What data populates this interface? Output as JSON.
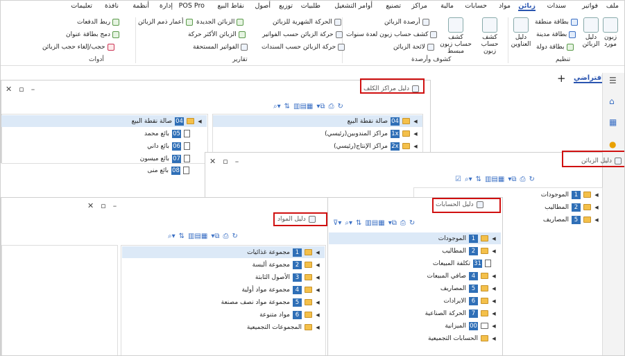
{
  "menu": {
    "items": [
      "ملف",
      "فواتير",
      "سندات",
      "زبائن",
      "مواد",
      "حسابات",
      "مالية",
      "مراكز",
      "تصنيع",
      "أوامر التشغيل",
      "طلبيات",
      "توزيع",
      "أصول",
      "نقاط البيع",
      "POS Pro",
      "إدارة",
      "أنظمة",
      "نافذة",
      "تعليمات"
    ],
    "active": "زبائن"
  },
  "ribbon": {
    "tanzeem": {
      "label": "تنظيم",
      "btn_customer_supplier": "زبون مورد",
      "btn_customers_guide": "دليل الزبائن",
      "btn_region_card": "بطاقة منطقة",
      "btn_city_card": "بطاقة مدينة",
      "btn_country_card": "بطاقة دولة",
      "btn_address_guide": "دليل العناوين"
    },
    "kashf": {
      "label": "كشوف وأرصدة",
      "btn_customer_statement": "كشف حساب زبون",
      "btn_simple_statement": "كشف حساب زبون مبسط",
      "btn_balances": "أرصدة الزبائن",
      "btn_multi_year": "كشف حساب زبون لعدة سنوات",
      "btn_list": "لائحة الزبائن"
    },
    "reports": {
      "label": "تقارير",
      "btn_monthly": "الحركة الشهرية للزبائن",
      "btn_by_invoices": "حركة الزبائن حسب الفواتير",
      "btn_by_vouchers": "حركة الزبائن حسب السندات",
      "btn_new": "الزبائن الجديدة",
      "btn_most_active": "الزبائن الأكثر حركة",
      "btn_due": "الفواتير المستحقة",
      "btn_aging": "أعمار ذمم الزبائن"
    },
    "tools": {
      "label": "أدوات",
      "btn_link_payments": "ربط الدفعات",
      "btn_merge_address": "دمج بطاقة عنوان",
      "btn_hide_customers": "حجب/إلغاء حجب الزبائن"
    }
  },
  "tabs": {
    "default_tab": "افتراضي",
    "add": "+"
  },
  "cost_centers": {
    "title": "دليل مراكز الكلف",
    "left_rows": [
      {
        "num": "04",
        "label": "صالة نقطة البيع",
        "type": "folder",
        "selected": true
      },
      {
        "num": "05",
        "label": "بائع محمد",
        "type": "doc"
      },
      {
        "num": "06",
        "label": "بائع داني",
        "type": "doc"
      },
      {
        "num": "07",
        "label": "بائع ميسون",
        "type": "doc"
      },
      {
        "num": "08",
        "label": "بائع منى",
        "type": "doc"
      }
    ],
    "right_rows": [
      {
        "num": "04",
        "label": "صالة نقطة البيع",
        "type": "folder",
        "selected": true
      },
      {
        "num": "1x",
        "label": "مراكز المندوبين(رئيسي)",
        "type": "folder"
      },
      {
        "num": "2x",
        "label": "مراكز الإنتاج(رئيسي)",
        "type": "folder"
      }
    ]
  },
  "customers": {
    "title": "دليل الزبائن",
    "rows": [
      {
        "num": "1",
        "label": "الموجودات"
      },
      {
        "num": "2",
        "label": "المطاليب"
      },
      {
        "num": "5",
        "label": "المصاريف"
      }
    ]
  },
  "accounts": {
    "title": "دليل الحسابات",
    "rows": [
      {
        "num": "1",
        "label": "الموجودات",
        "type": "folder",
        "selected": true
      },
      {
        "num": "2",
        "label": "المطاليب",
        "type": "folder"
      },
      {
        "num": "31",
        "label": "تكلفة المبيعات",
        "type": "doc"
      },
      {
        "num": "4",
        "label": "صافي المبيعات",
        "type": "folder"
      },
      {
        "num": "5",
        "label": "المصاريف",
        "type": "folder"
      },
      {
        "num": "6",
        "label": "الايرادات",
        "type": "folder"
      },
      {
        "num": "7",
        "label": "الحركة الصناعية",
        "type": "folder"
      },
      {
        "num": "00",
        "label": "الميزانية",
        "type": "folder"
      },
      {
        "num": "",
        "label": "الحسابات التجميعية",
        "type": "folder"
      }
    ]
  },
  "materials": {
    "title": "دليل المواد",
    "rows": [
      {
        "num": "1",
        "label": "مجموعة غذائيات",
        "selected": true
      },
      {
        "num": "2",
        "label": "مجموعة ألبسة"
      },
      {
        "num": "3",
        "label": "الأصول الثابتة"
      },
      {
        "num": "4",
        "label": "مجموعة مواد أولية"
      },
      {
        "num": "5",
        "label": "مجموعة مواد نصف مصنعة"
      },
      {
        "num": "6",
        "label": "مواد متنوعة"
      },
      {
        "num": "",
        "label": "المجموعات التجميعية"
      }
    ]
  },
  "icons": {
    "menu": "hamburger-icon",
    "home": "home-icon",
    "calendar": "calendar-icon",
    "bulb": "bulb-icon"
  }
}
